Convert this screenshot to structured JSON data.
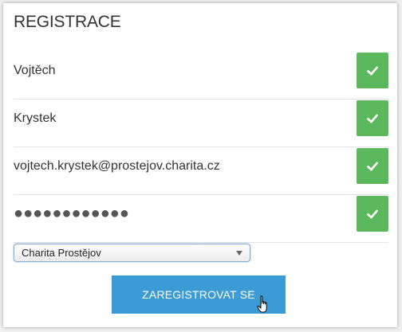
{
  "form": {
    "title": "REGISTRACE",
    "first_name": "Vojtěch",
    "last_name": "Krystek",
    "email": "vojtech.krystek@prostejov.charita.cz",
    "password_mask": "●●●●●●●●●●●●",
    "organization_selected": "Charita Prostějov",
    "submit_label": "ZAREGISTROVAT SE"
  },
  "icons": {
    "valid": "check-icon",
    "cursor": "hand-pointer-icon",
    "select_arrow": "triangle-down-icon"
  },
  "colors": {
    "valid_green": "#5cb85c",
    "button_blue": "#3a9bd5",
    "select_focus": "#8aaed6"
  }
}
